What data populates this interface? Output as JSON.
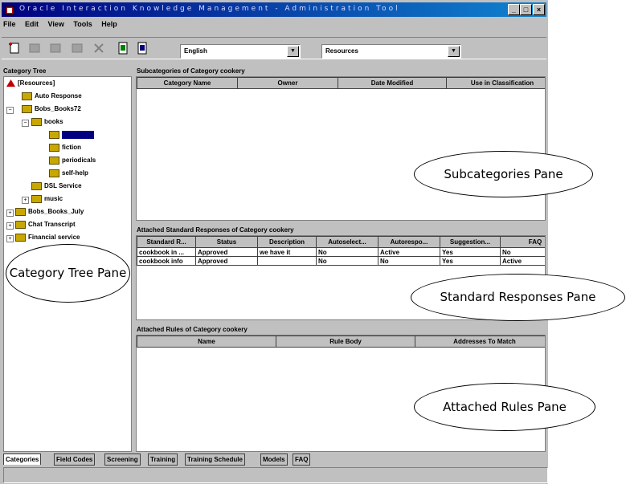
{
  "window": {
    "title": "Oracle Interaction Knowledge Management - Administration Tool",
    "min": "_",
    "max": "□",
    "close": "×"
  },
  "menu": [
    "File",
    "Edit",
    "View",
    "Tools",
    "Help"
  ],
  "toolbar": {
    "language": "English",
    "resource": "Resources"
  },
  "tree": {
    "title": "Category Tree",
    "nodes": [
      "[Resources]",
      "Auto Response",
      "Bobs_Books72",
      "books",
      "",
      "fiction",
      "periodicals",
      "self-help",
      "DSL Service",
      "music",
      "Bobs_Books_July",
      "Chat Transcript",
      "Financial service"
    ]
  },
  "subcategories": {
    "title": "Subcategories of Category cookery",
    "columns": [
      "Category Name",
      "Owner",
      "Date Modified",
      "Use in Classification"
    ]
  },
  "responses": {
    "title": "Attached Standard Responses of Category cookery",
    "columns": [
      "Standard R...",
      "Status",
      "Description",
      "Autoselect...",
      "Autorespo...",
      "Suggestion...",
      "FAQ"
    ],
    "rows": [
      [
        "cookbook in ...",
        "Approved",
        "we have it",
        "No",
        "Active",
        "Yes",
        "No"
      ],
      [
        "cookbook info",
        "Approved",
        "",
        "No",
        "No",
        "Yes",
        "Active"
      ]
    ]
  },
  "rules": {
    "title": "Attached Rules of Category cookery",
    "columns": [
      "Name",
      "Rule Body",
      "Addresses To Match"
    ]
  },
  "tabs": [
    "Categories",
    "Field Codes",
    "Screening",
    "Training",
    "Training Schedule",
    "Models",
    "FAQ"
  ],
  "callouts": {
    "subcategories": "Subcategories Pane",
    "tree": "Category Tree Pane",
    "responses": "Standard Responses Pane",
    "rules": "Attached Rules Pane"
  }
}
